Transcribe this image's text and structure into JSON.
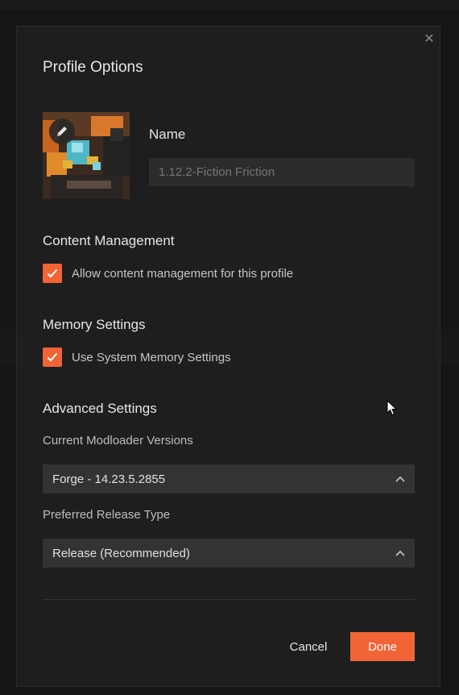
{
  "dialog": {
    "title": "Profile Options",
    "close_icon": "close-icon"
  },
  "profile": {
    "avatar_icon": "edit-pencil-icon",
    "name_label": "Name",
    "name_placeholder": "1.12.2-Fiction Friction"
  },
  "content_management": {
    "title": "Content Management",
    "checkbox_label": "Allow content management for this profile",
    "checked": true
  },
  "memory_settings": {
    "title": "Memory Settings",
    "checkbox_label": "Use System Memory Settings",
    "checked": true
  },
  "advanced_settings": {
    "title": "Advanced Settings",
    "modloader_label": "Current Modloader Versions",
    "modloader_value": "Forge - 14.23.5.2855",
    "release_type_label": "Preferred Release Type",
    "release_type_value": "Release (Recommended)"
  },
  "actions": {
    "cancel_label": "Cancel",
    "done_label": "Done"
  },
  "colors": {
    "accent": "#f16436",
    "dialog_bg": "#1e1e1e",
    "input_bg": "#2c2c2c",
    "select_bg": "#333333"
  }
}
